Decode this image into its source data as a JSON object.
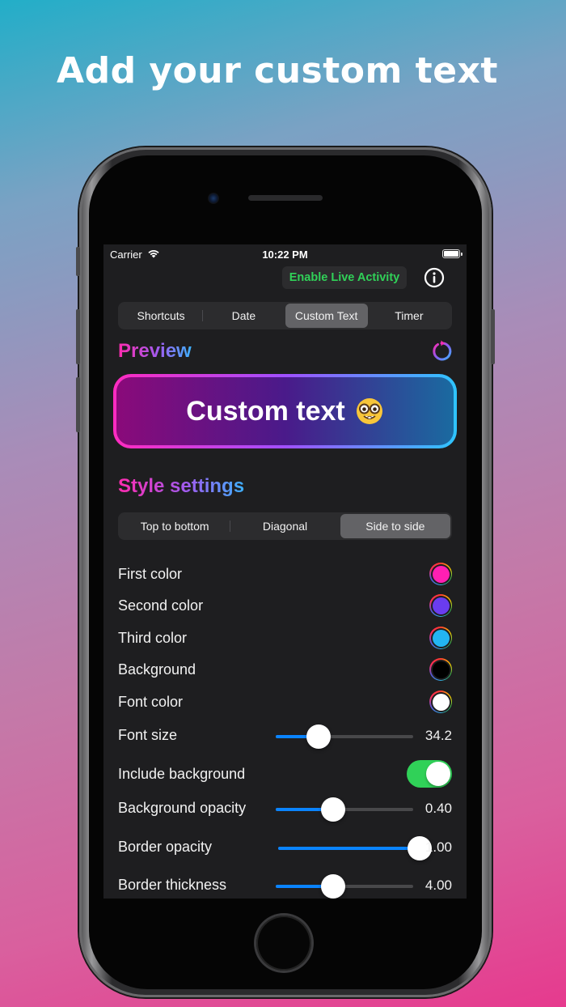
{
  "headline": "Add your custom text",
  "status": {
    "carrier": "Carrier",
    "time": "10:22 PM"
  },
  "header": {
    "live_activity_label": "Enable Live Activity"
  },
  "tabs": [
    {
      "label": "Shortcuts",
      "selected": false
    },
    {
      "label": "Date",
      "selected": false
    },
    {
      "label": "Custom Text",
      "selected": true
    },
    {
      "label": "Timer",
      "selected": false
    }
  ],
  "preview": {
    "title": "Preview",
    "text": "Custom text"
  },
  "style": {
    "title": "Style settings",
    "directions": [
      {
        "label": "Top to bottom",
        "selected": false
      },
      {
        "label": "Diagonal",
        "selected": false
      },
      {
        "label": "Side to side",
        "selected": true
      }
    ],
    "colors": [
      {
        "label": "First color",
        "color": "#ff1fb3"
      },
      {
        "label": "Second color",
        "color": "#6a3cf0"
      },
      {
        "label": "Third color",
        "color": "#23b5f2"
      },
      {
        "label": "Background",
        "color": "#000000"
      },
      {
        "label": "Font color",
        "color": "#ffffff"
      }
    ],
    "font_size": {
      "label": "Font size",
      "value": "34.2",
      "fraction": 0.31
    },
    "include_background": {
      "label": "Include background",
      "on": true
    },
    "background_opacity": {
      "label": "Background opacity",
      "value": "0.40",
      "fraction": 0.42
    },
    "border_opacity": {
      "label": "Border opacity",
      "value": "1.00",
      "fraction": 1.0
    },
    "border_thickness": {
      "label": "Border thickness",
      "value": "4.00",
      "fraction": 0.42
    }
  },
  "theme": {
    "accent": "#0a84ff",
    "toggle_on": "#30d158",
    "live_activity_text": "#30d158"
  }
}
